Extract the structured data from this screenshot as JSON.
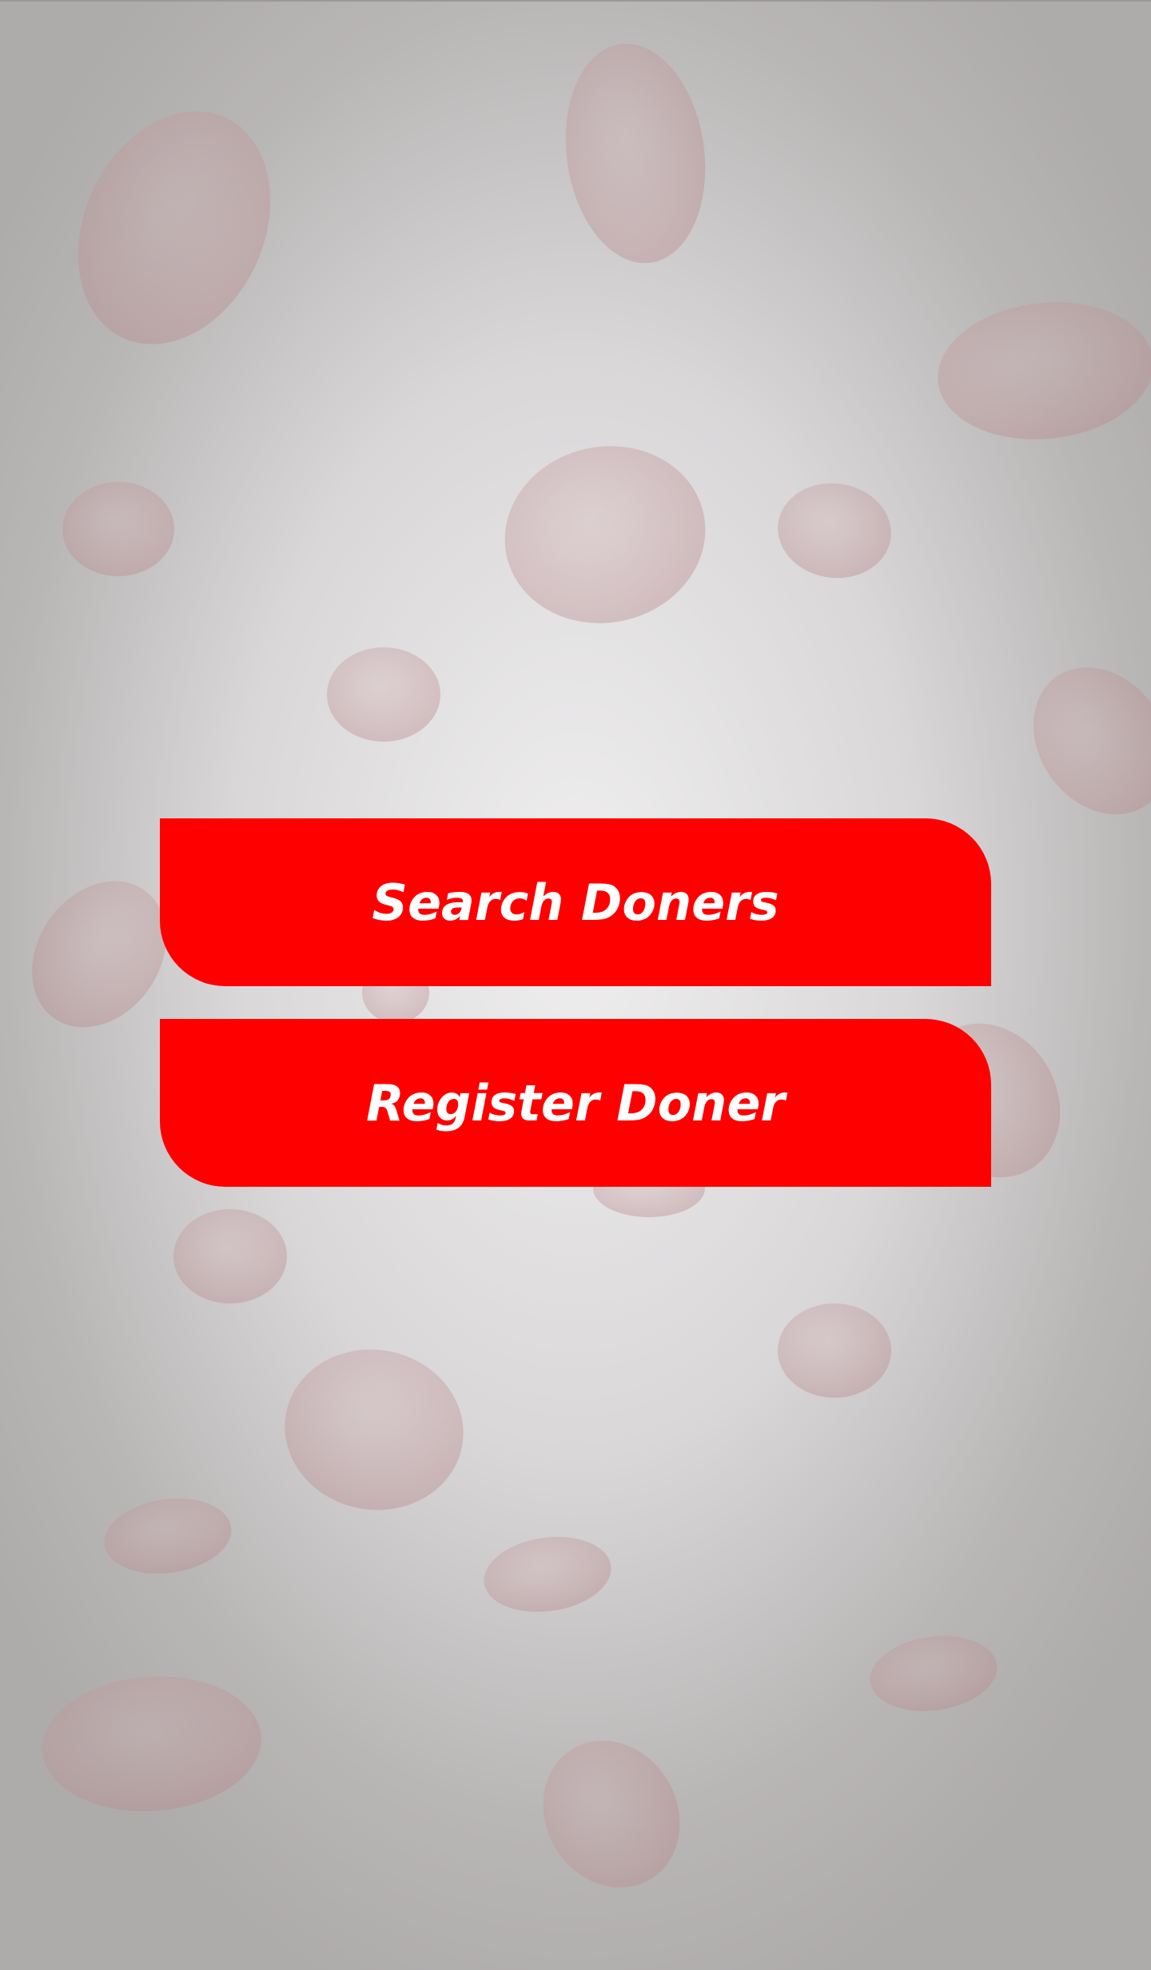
{
  "screen": {
    "background": "blood-cells-gradient",
    "accent_color": "#ff0000",
    "button_text_color": "#ffffff",
    "cell_color": "#c89a9c"
  },
  "actions": {
    "search_label": "Search Doners",
    "register_label": "Register Doner"
  }
}
